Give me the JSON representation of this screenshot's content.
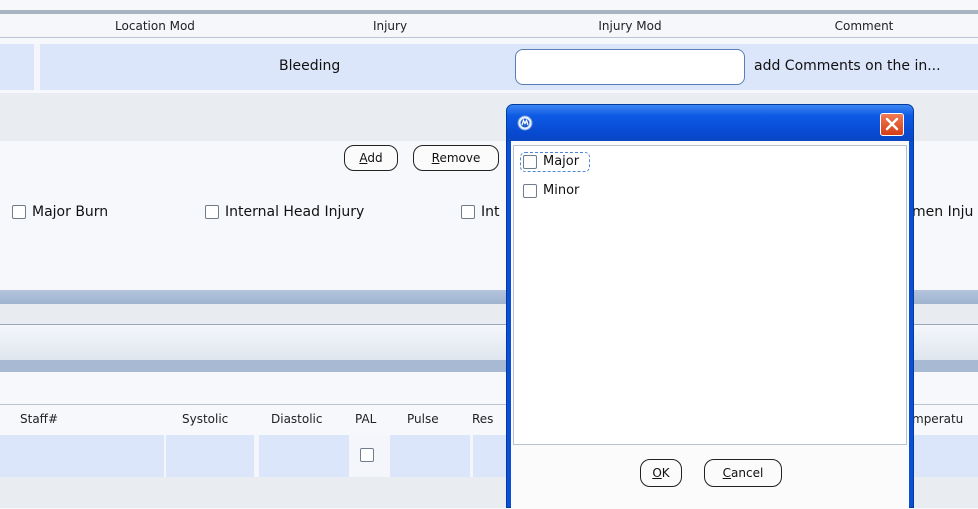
{
  "table": {
    "columns": [
      "Location Mod",
      "Injury",
      "Injury Mod",
      "Comment"
    ],
    "row": {
      "injury": "Bleeding",
      "injury_mod": "",
      "comment": "add Comments on the in..."
    }
  },
  "buttons": {
    "add": {
      "mnemonic": "A",
      "rest": "dd"
    },
    "remove": {
      "mnemonic": "R",
      "rest": "emove"
    }
  },
  "injury_checkboxes": [
    "Major Burn",
    "Internal Head Injury",
    "Int",
    "men Inju"
  ],
  "vitals": {
    "columns": [
      "Staff#",
      "Systolic",
      "Diastolic",
      "PAL",
      "Pulse",
      "Res",
      "mperatu"
    ]
  },
  "dialog": {
    "options": [
      "Major",
      "Minor"
    ],
    "ok": {
      "mnemonic": "O",
      "rest": "K"
    },
    "cancel": {
      "mnemonic": "C",
      "rest": "ancel"
    }
  }
}
